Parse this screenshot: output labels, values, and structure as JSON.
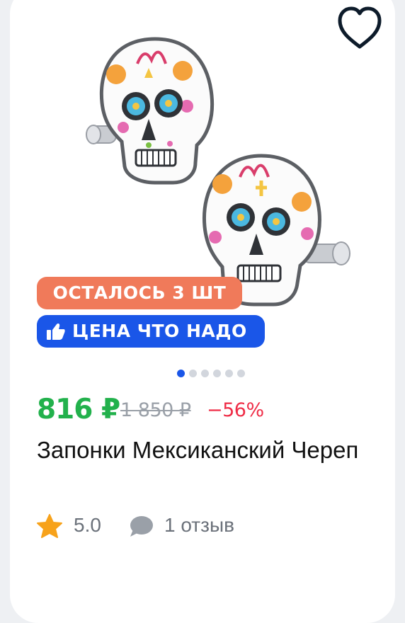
{
  "badges": {
    "stock": "ОСТАЛОСЬ 3 ШТ",
    "price_tag": "ЦЕНА ЧТО НАДО"
  },
  "gallery": {
    "image_count": 6,
    "active_index": 0
  },
  "price": {
    "current": "816 ₽",
    "old": "1 850 ₽",
    "discount": "−56%"
  },
  "product": {
    "title": "Запонки Мексиканский Череп"
  },
  "rating": {
    "value": "5.0",
    "reviews": "1 отзыв"
  },
  "colors": {
    "stock_badge": "#f07a5a",
    "price_badge": "#1a56e8",
    "price_current": "#22b14c",
    "discount": "#ef2d47",
    "star": "#f7a21b"
  }
}
